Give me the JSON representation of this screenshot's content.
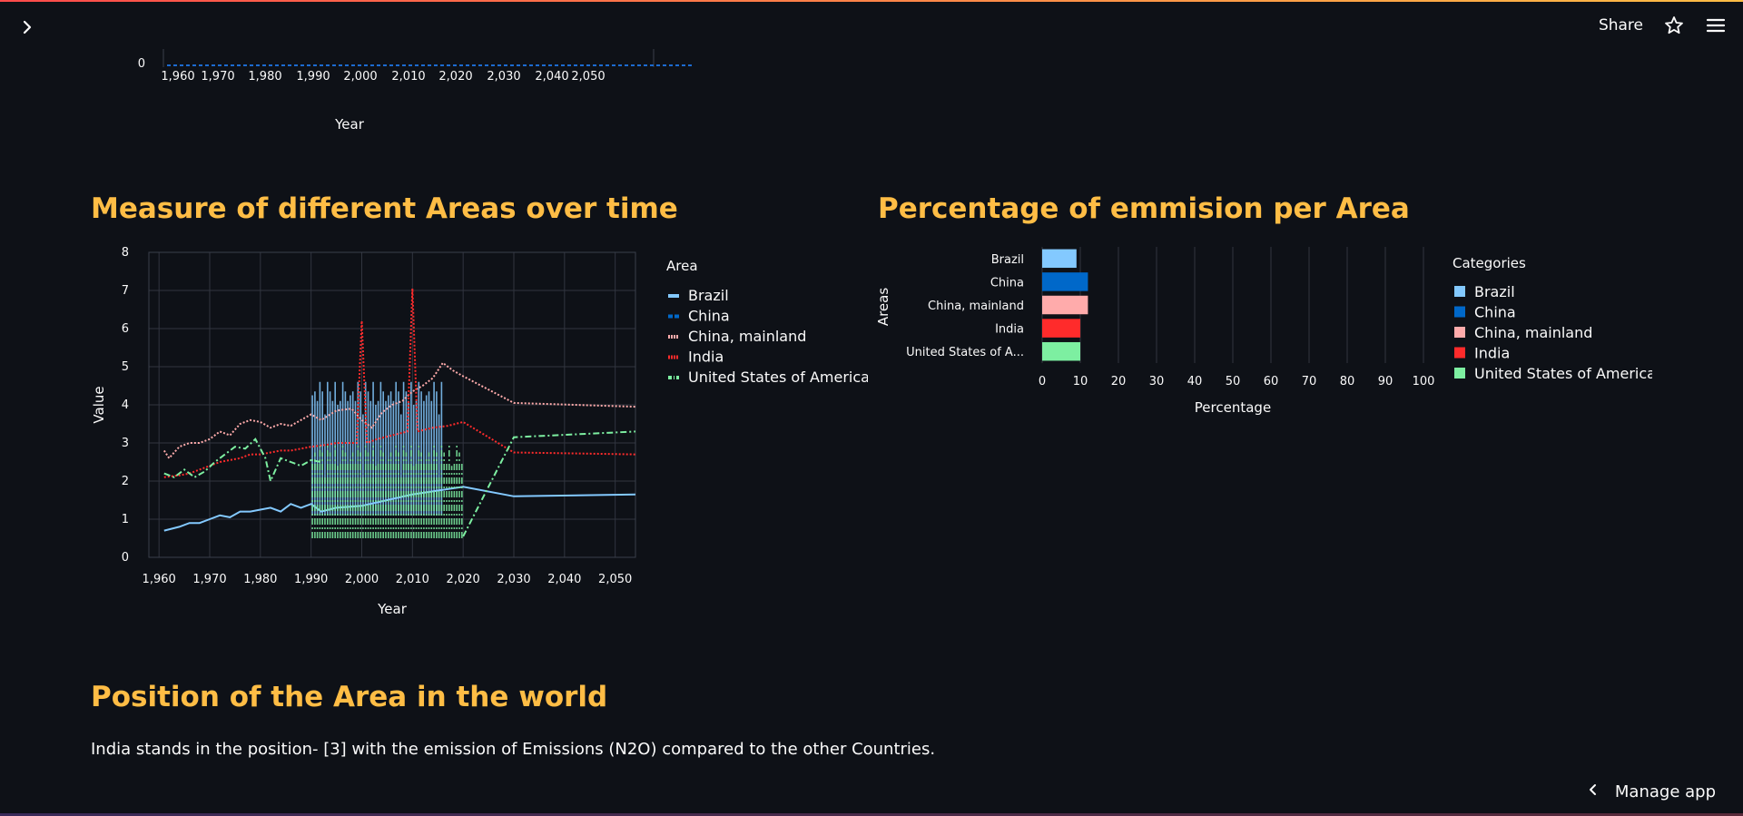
{
  "header": {
    "share_label": "Share",
    "sidebar_toggle_icon": "chevron-right-icon",
    "star_icon": "star-icon",
    "menu_icon": "hamburger-menu-icon"
  },
  "top_chart": {
    "x_ticks": [
      "1,960",
      "1,970",
      "1,980",
      "1,990",
      "2,000",
      "2,010",
      "2,020",
      "2,030",
      "2,040",
      "2,050"
    ],
    "y_tick": "0",
    "xlabel": "Year"
  },
  "sections": {
    "measure_title": "Measure of different Areas over time",
    "percentage_title": "Percentage of emmision per Area",
    "position_title": "Position of the Area in the world",
    "position_text": "India stands in the position- [3] with the emission of Emissions (N2O) compared to the other Countries."
  },
  "colors": {
    "accent": "#ffbd45",
    "background": "#0e1117",
    "brazil": "#83c9ff",
    "china": "#0068c9",
    "china_mainland": "#ffabab",
    "india": "#ff2b2b",
    "usa": "#7defa1"
  },
  "chart_data": [
    {
      "type": "line",
      "title": "Measure of different Areas over time",
      "xlabel": "Year",
      "ylabel": "Value",
      "legend_title": "Area",
      "legend_position": "right",
      "xlim": [
        1958,
        2054
      ],
      "ylim": [
        0,
        8
      ],
      "x_ticks": [
        1960,
        1970,
        1980,
        1990,
        2000,
        2010,
        2020,
        2030,
        2040,
        2050
      ],
      "x_tick_labels": [
        "1,960",
        "1,970",
        "1,980",
        "1,990",
        "2,000",
        "2,010",
        "2,020",
        "2,030",
        "2,040",
        "2,050"
      ],
      "y_ticks": [
        0,
        1,
        2,
        3,
        4,
        5,
        6,
        7,
        8
      ],
      "grid": true,
      "series": [
        {
          "name": "Brazil",
          "style": "solid",
          "color": "#83c9ff",
          "points": [
            [
              1961,
              0.7
            ],
            [
              1964,
              0.8
            ],
            [
              1966,
              0.9
            ],
            [
              1968,
              0.9
            ],
            [
              1970,
              1.0
            ],
            [
              1972,
              1.1
            ],
            [
              1974,
              1.05
            ],
            [
              1976,
              1.2
            ],
            [
              1978,
              1.2
            ],
            [
              1980,
              1.25
            ],
            [
              1982,
              1.3
            ],
            [
              1984,
              1.2
            ],
            [
              1986,
              1.4
            ],
            [
              1988,
              1.3
            ],
            [
              1990,
              1.4
            ],
            [
              1992,
              1.2
            ],
            [
              1995,
              1.3
            ],
            [
              2000,
              1.35
            ],
            [
              2005,
              1.5
            ],
            [
              2010,
              1.65
            ],
            [
              2015,
              1.75
            ],
            [
              2020,
              1.85
            ],
            [
              2030,
              1.6
            ],
            [
              2054,
              1.65
            ]
          ],
          "spikes": {
            "from": 1990,
            "to": 2016,
            "low": 1.1,
            "high": 4.6
          }
        },
        {
          "name": "China",
          "style": "dashed",
          "color": "#0068c9",
          "points": []
        },
        {
          "name": "China, mainland",
          "style": "dotted",
          "color": "#ffabab",
          "points": [
            [
              1961,
              2.8
            ],
            [
              1962,
              2.6
            ],
            [
              1964,
              2.9
            ],
            [
              1966,
              3.0
            ],
            [
              1968,
              3.0
            ],
            [
              1970,
              3.1
            ],
            [
              1972,
              3.3
            ],
            [
              1974,
              3.2
            ],
            [
              1976,
              3.5
            ],
            [
              1978,
              3.6
            ],
            [
              1980,
              3.55
            ],
            [
              1982,
              3.4
            ],
            [
              1984,
              3.5
            ],
            [
              1986,
              3.45
            ],
            [
              1988,
              3.6
            ],
            [
              1990,
              3.75
            ],
            [
              1992,
              3.6
            ],
            [
              1995,
              3.85
            ],
            [
              1998,
              3.9
            ],
            [
              2000,
              3.6
            ],
            [
              2002,
              3.4
            ],
            [
              2004,
              3.8
            ],
            [
              2006,
              4.0
            ],
            [
              2008,
              4.1
            ],
            [
              2010,
              4.35
            ],
            [
              2012,
              4.5
            ],
            [
              2014,
              4.7
            ],
            [
              2016,
              5.1
            ],
            [
              2018,
              4.9
            ],
            [
              2020,
              4.75
            ],
            [
              2030,
              4.05
            ],
            [
              2054,
              3.95
            ]
          ]
        },
        {
          "name": "India",
          "style": "dotted",
          "color": "#ff2b2b",
          "points": [
            [
              1961,
              2.1
            ],
            [
              1964,
              2.15
            ],
            [
              1966,
              2.2
            ],
            [
              1968,
              2.3
            ],
            [
              1970,
              2.4
            ],
            [
              1972,
              2.5
            ],
            [
              1974,
              2.55
            ],
            [
              1976,
              2.6
            ],
            [
              1978,
              2.7
            ],
            [
              1980,
              2.7
            ],
            [
              1982,
              2.75
            ],
            [
              1984,
              2.8
            ],
            [
              1986,
              2.8
            ],
            [
              1988,
              2.85
            ],
            [
              1990,
              2.9
            ],
            [
              1993,
              2.95
            ],
            [
              1995,
              3.0
            ],
            [
              1999,
              3.0
            ],
            [
              2000,
              6.2
            ],
            [
              2001,
              3.0
            ],
            [
              2003,
              3.1
            ],
            [
              2006,
              3.2
            ],
            [
              2009,
              3.3
            ],
            [
              2010,
              7.05
            ],
            [
              2011,
              3.3
            ],
            [
              2014,
              3.4
            ],
            [
              2017,
              3.45
            ],
            [
              2020,
              3.55
            ],
            [
              2030,
              2.75
            ],
            [
              2054,
              2.7
            ]
          ]
        },
        {
          "name": "United States of America",
          "style": "dashdot",
          "color": "#7defa1",
          "points": [
            [
              1961,
              2.2
            ],
            [
              1963,
              2.1
            ],
            [
              1965,
              2.3
            ],
            [
              1967,
              2.1
            ],
            [
              1969,
              2.25
            ],
            [
              1971,
              2.5
            ],
            [
              1973,
              2.7
            ],
            [
              1975,
              2.9
            ],
            [
              1977,
              2.85
            ],
            [
              1979,
              3.1
            ],
            [
              1981,
              2.6
            ],
            [
              1982,
              2.0
            ],
            [
              1984,
              2.6
            ],
            [
              1986,
              2.5
            ],
            [
              1988,
              2.4
            ],
            [
              1990,
              2.55
            ],
            [
              1992,
              2.5
            ]
          ],
          "spikes": {
            "from": 1990,
            "to": 2020,
            "low": 0.5,
            "high": 3.0
          },
          "tail": [
            [
              2020,
              0.55
            ],
            [
              2030,
              3.15
            ],
            [
              2054,
              3.3
            ]
          ]
        }
      ]
    },
    {
      "type": "bar",
      "orientation": "horizontal",
      "title": "Percentage of emmision per Area",
      "xlabel": "Percentage",
      "ylabel": "Areas",
      "legend_title": "Categories",
      "legend_position": "right",
      "xlim": [
        0,
        100
      ],
      "x_ticks": [
        0,
        10,
        20,
        30,
        40,
        50,
        60,
        70,
        80,
        90,
        100
      ],
      "grid": true,
      "categories": [
        "Brazil",
        "China",
        "China, mainland",
        "India",
        "United States of A..."
      ],
      "legend_labels": [
        "Brazil",
        "China",
        "China, mainland",
        "India",
        "United States of America"
      ],
      "values": [
        9,
        12,
        12,
        10,
        10
      ],
      "colors": [
        "#83c9ff",
        "#0068c9",
        "#ffabab",
        "#ff2b2b",
        "#7defa1"
      ]
    }
  ],
  "footer": {
    "manage_app_label": "Manage app",
    "manage_icon": "chevron-left-icon"
  }
}
